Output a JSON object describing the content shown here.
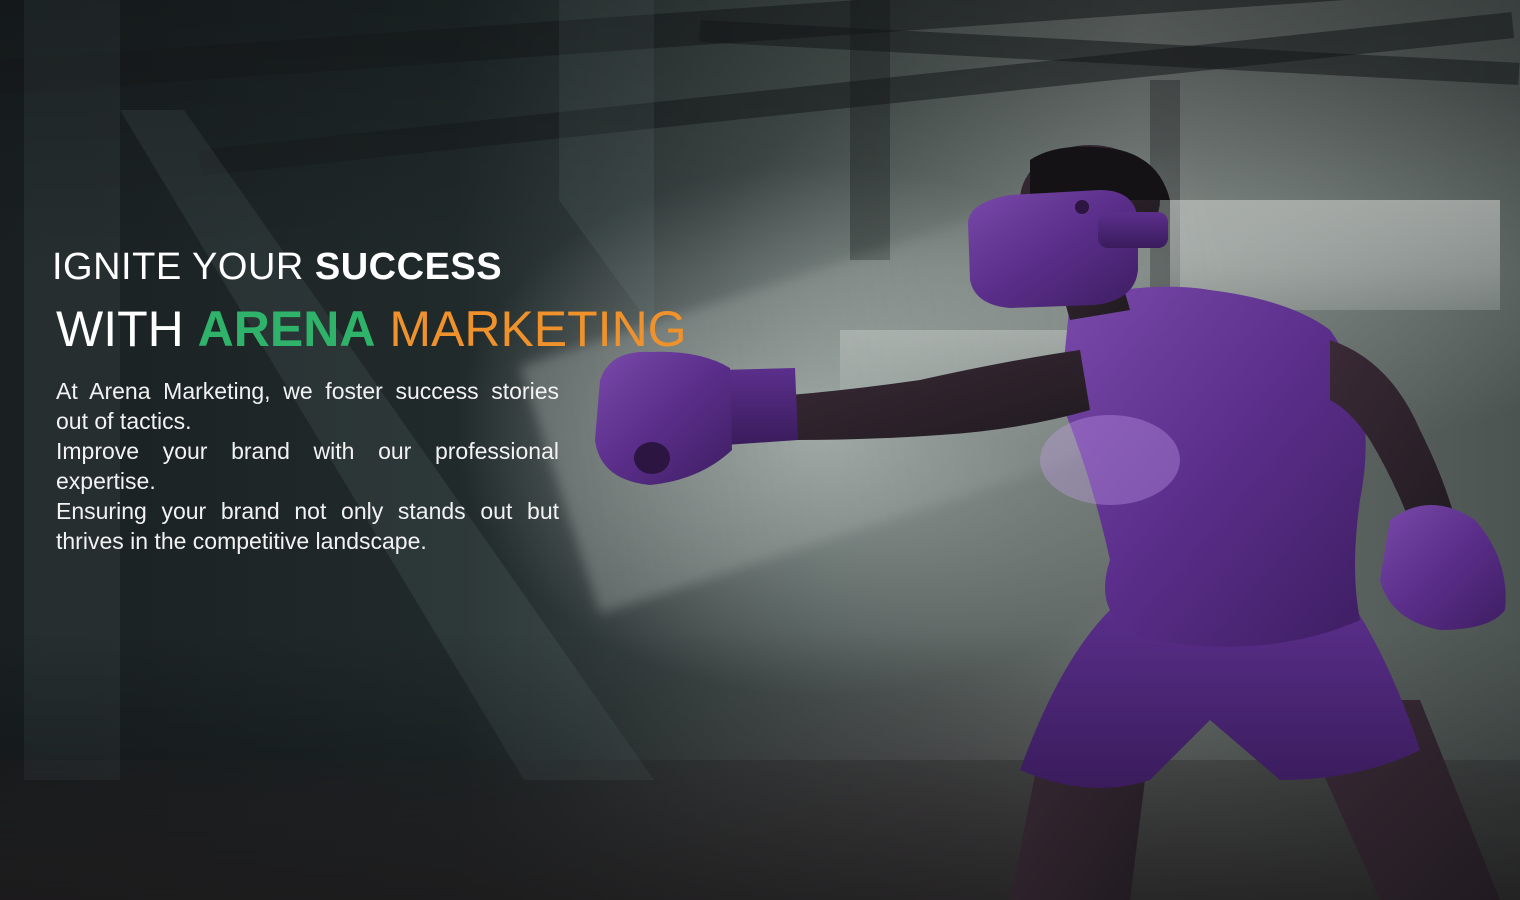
{
  "headline": {
    "line1_regular": "IGNITE YOUR ",
    "line1_bold": "SUCCESS",
    "line2_white": "WITH ",
    "line2_green": "ARENA",
    "line2_orange": " MARKETING"
  },
  "body": {
    "paragraph1": "At Arena Marketing, we foster success stories out of tactics.",
    "paragraph2": "Improve your brand with our professional expertise.",
    "paragraph3": "Ensuring your brand not only stands out but thrives in the competitive landscape."
  },
  "colors": {
    "green": "#2fb36a",
    "orange": "#f0922b",
    "purple": "#5a2e8a"
  },
  "icons": {
    "logo": "arena-n-logo",
    "figure": "vr-boxer-illustration"
  }
}
